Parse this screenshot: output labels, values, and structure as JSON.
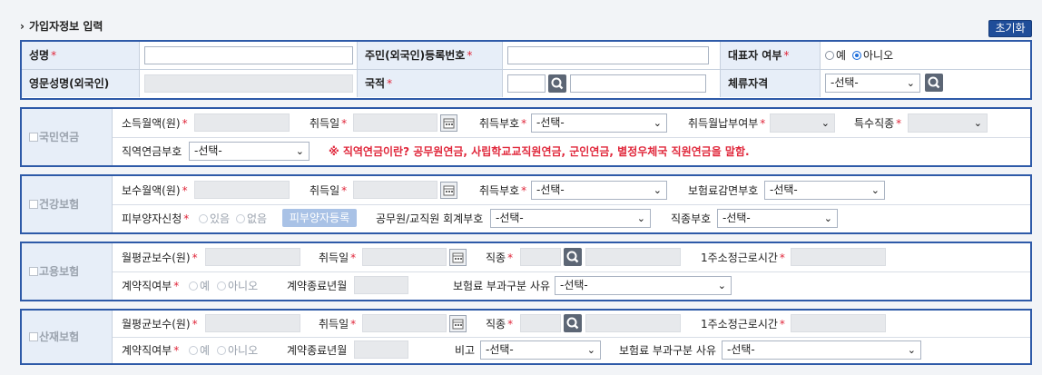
{
  "section_title": "가입자정보 입력",
  "reset_label": "초기화",
  "required_mark": "*",
  "main": {
    "name_label": "성명",
    "rrn_label": "주민(외국인)등록번호",
    "rep_label": "대표자 여부",
    "rep_yes": "예",
    "rep_no": "아니오",
    "eng_name_label": "영문성명(외국인)",
    "nationality_label": "국적",
    "visa_label": "체류자격",
    "select_placeholder": "-선택-"
  },
  "pension": {
    "title": "국민연금",
    "income_label": "소득월액(원)",
    "acq_date_label": "취득일",
    "acq_code_label": "취득부호",
    "acq_month_pay_label": "취득월납부여부",
    "special_job_label": "특수직종",
    "job_pension_label": "직역연금부호",
    "notice": "※ 직역연금이란? 공무원연금, 사립학교교직원연금, 군인연금, 별정우체국 직원연금을 말함."
  },
  "health": {
    "title": "건강보험",
    "pay_label": "보수월액(원)",
    "acq_date_label": "취득일",
    "acq_code_label": "취득부호",
    "reduction_label": "보험료감면부호",
    "dependent_label": "피부양자신청",
    "dep_yes": "있음",
    "dep_no": "없음",
    "dep_button": "피부양자등록",
    "account_label": "공무원/교직원 회계부호",
    "job_code_label": "직종부호"
  },
  "employment": {
    "title": "고용보험",
    "avg_pay_label": "월평균보수(원)",
    "acq_date_label": "취득일",
    "job_label": "직종",
    "hours_label": "1주소정근로시간",
    "contract_label": "계약직여부",
    "yes": "예",
    "no": "아니오",
    "end_label": "계약종료년월",
    "reason_label": "보험료 부과구분 사유"
  },
  "accident": {
    "title": "산재보험",
    "avg_pay_label": "월평균보수(원)",
    "acq_date_label": "취득일",
    "job_label": "직종",
    "hours_label": "1주소정근로시간",
    "contract_label": "계약직여부",
    "yes": "예",
    "no": "아니오",
    "end_label": "계약종료년월",
    "remark_label": "비고",
    "reason_label": "보험료 부과구분 사유"
  }
}
